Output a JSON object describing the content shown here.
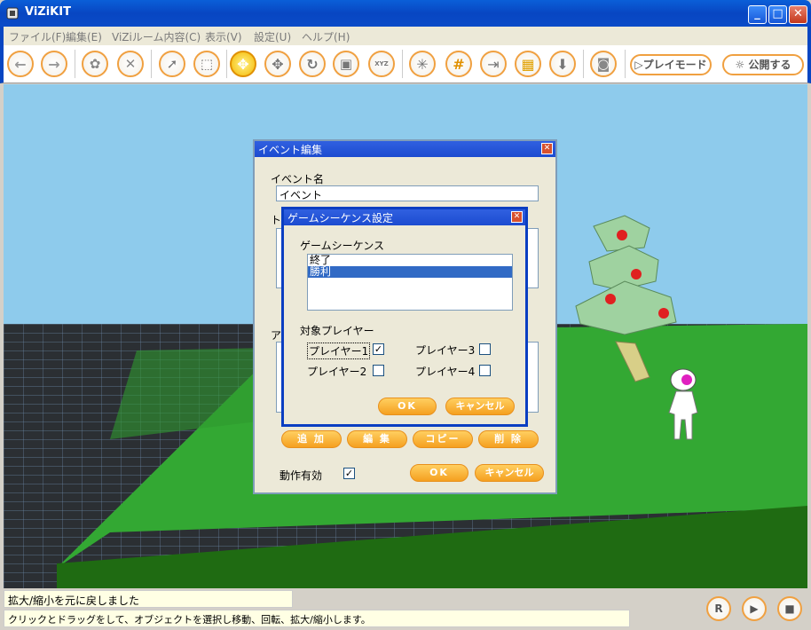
{
  "window": {
    "title": "ViZiKIT",
    "minimize": "_",
    "maximize": "□",
    "close": "✕"
  },
  "menu": [
    "ファイル(F)",
    "編集(E)",
    "ViZiルーム内容(C)",
    "表示(V)",
    "設定(U)",
    "ヘルプ(H)"
  ],
  "toolbar": {
    "buttons": [
      {
        "name": "back-icon",
        "glyph": "←"
      },
      {
        "name": "forward-icon",
        "glyph": "→"
      },
      {
        "name": "object-add-icon",
        "glyph": "✿"
      },
      {
        "name": "delete-icon",
        "glyph": "✕"
      },
      {
        "name": "select-arrow-icon",
        "glyph": "➚"
      },
      {
        "name": "select-area-icon",
        "glyph": "⬚"
      },
      {
        "name": "move-icon",
        "glyph": "✥"
      },
      {
        "name": "pan-icon",
        "glyph": "✥"
      },
      {
        "name": "rotate-icon",
        "glyph": "↻"
      },
      {
        "name": "scale-icon",
        "glyph": "▣"
      },
      {
        "name": "xyz-icon",
        "glyph": "XYZ"
      },
      {
        "name": "axes-icon",
        "glyph": "✳"
      },
      {
        "name": "grid-on-icon",
        "glyph": "#"
      },
      {
        "name": "snap-off-icon",
        "glyph": "⇥"
      },
      {
        "name": "box-on-icon",
        "glyph": "▦"
      },
      {
        "name": "download-icon",
        "glyph": "⬇"
      },
      {
        "name": "camera-icon",
        "glyph": "◙"
      }
    ],
    "play_mode": "▷プレイモード",
    "publish": "☼ 公開する"
  },
  "event_dialog": {
    "title": "イベント編集",
    "event_name_label": "イベント名",
    "event_name_value": "イベント",
    "trigger_label": "ト",
    "action_label": "ア",
    "add": "追 加",
    "edit": "編 集",
    "copy": "コピー",
    "remove": "削 除",
    "enabled_label": "動作有効",
    "ok": "OK",
    "cancel": "キャンセル"
  },
  "seq_dialog": {
    "title": "ゲームシーケンス設定",
    "sequence_label": "ゲームシーケンス",
    "sequences": [
      "終了",
      "勝利"
    ],
    "selected_index": 1,
    "target_label": "対象プレイヤー",
    "players": [
      {
        "label": "プレイヤー1",
        "checked": true
      },
      {
        "label": "プレイヤー2",
        "checked": false
      },
      {
        "label": "プレイヤー3",
        "checked": false
      },
      {
        "label": "プレイヤー4",
        "checked": false
      }
    ],
    "ok": "OK",
    "cancel": "キャンセル"
  },
  "status": {
    "line1": "拡大/縮小を元に戻しました",
    "line2": "クリックとドラッグをして、オブジェクトを選択し移動、回転、拡大/縮小します。"
  },
  "controls": {
    "reset": "R",
    "play": "▶",
    "stop": "■"
  }
}
